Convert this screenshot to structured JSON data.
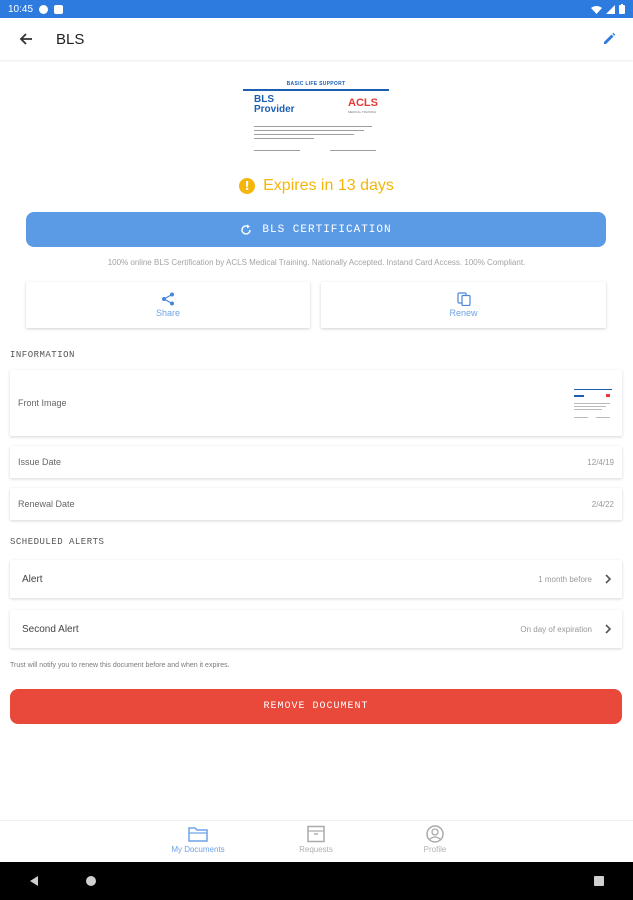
{
  "status_bar": {
    "time": "10:45"
  },
  "app_bar": {
    "title": "BLS"
  },
  "certificate_preview": {
    "header": "BASIC LIFE SUPPORT",
    "provider_line1": "BLS",
    "provider_line2": "Provider",
    "logo": "ACLS",
    "logo_sub": "MEDICAL TRAINING"
  },
  "expiry": {
    "text": "Expires in 13 days",
    "color": "#f5b50b"
  },
  "cert_button": {
    "label": "BLS CERTIFICATION",
    "color": "#5b9be6"
  },
  "cert_description": "100% online BLS Certification by ACLS Medical Training. Nationally Accepted. Instand Card Access. 100% Compliant.",
  "actions": [
    {
      "label": "Share",
      "icon": "share-icon"
    },
    {
      "label": "Renew",
      "icon": "copy-icon"
    }
  ],
  "information": {
    "section_label": "INFORMATION",
    "front_image_label": "Front Image",
    "issue_date_label": "Issue Date",
    "issue_date_value": "12/4/19",
    "renewal_date_label": "Renewal Date",
    "renewal_date_value": "2/4/22"
  },
  "alerts": {
    "section_label": "SCHEDULED ALERTS",
    "items": [
      {
        "label": "Alert",
        "value": "1 month before"
      },
      {
        "label": "Second Alert",
        "value": "On day of expiration"
      }
    ],
    "note": "Trust will notify you to renew this document before and when it expires."
  },
  "remove_button": {
    "label": "REMOVE DOCUMENT",
    "color": "#e8493b"
  },
  "bottom_nav": [
    {
      "label": "My Documents",
      "icon": "folder-icon",
      "active": true
    },
    {
      "label": "Requests",
      "icon": "inbox-icon",
      "active": false
    },
    {
      "label": "Profile",
      "icon": "profile-icon",
      "active": false
    }
  ],
  "accent_color": "#6fa3e8"
}
